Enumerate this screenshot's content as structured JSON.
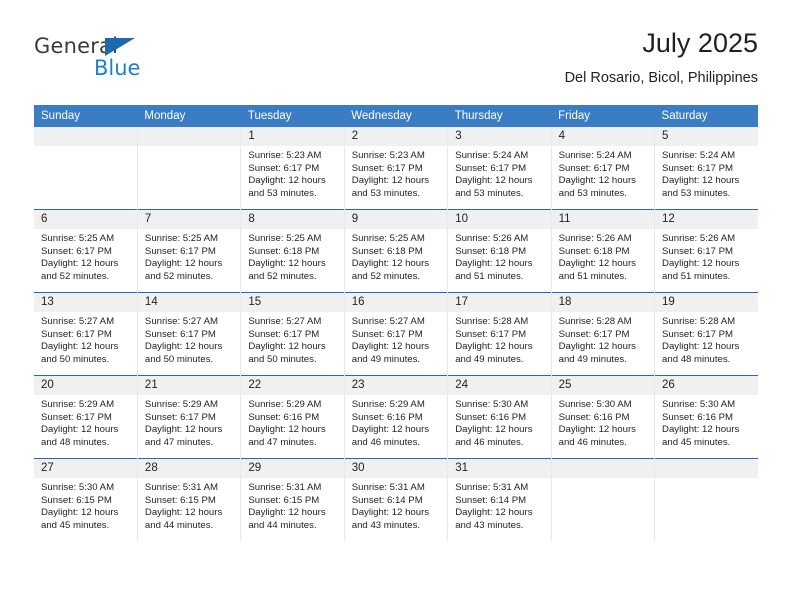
{
  "brand": {
    "name_top": "General",
    "name_bottom": "Blue",
    "triangle_icon": "triangle-icon",
    "color_dark": "#3b3b3b",
    "color_blue": "#1b7fd4",
    "color_triangle": "#1b68b3"
  },
  "header": {
    "title": "July 2025",
    "subtitle": "Del Rosario, Bicol, Philippines"
  },
  "colors": {
    "header_bar": "#3b7dc4",
    "row_divider": "#2a67ac",
    "day_band": "#f0f0f0",
    "text": "#231f20"
  },
  "weekdays": [
    "Sunday",
    "Monday",
    "Tuesday",
    "Wednesday",
    "Thursday",
    "Friday",
    "Saturday"
  ],
  "weeks": [
    [
      {
        "day": "",
        "lines": []
      },
      {
        "day": "",
        "lines": []
      },
      {
        "day": "1",
        "lines": [
          "Sunrise: 5:23 AM",
          "Sunset: 6:17 PM",
          "Daylight: 12 hours",
          "and 53 minutes."
        ]
      },
      {
        "day": "2",
        "lines": [
          "Sunrise: 5:23 AM",
          "Sunset: 6:17 PM",
          "Daylight: 12 hours",
          "and 53 minutes."
        ]
      },
      {
        "day": "3",
        "lines": [
          "Sunrise: 5:24 AM",
          "Sunset: 6:17 PM",
          "Daylight: 12 hours",
          "and 53 minutes."
        ]
      },
      {
        "day": "4",
        "lines": [
          "Sunrise: 5:24 AM",
          "Sunset: 6:17 PM",
          "Daylight: 12 hours",
          "and 53 minutes."
        ]
      },
      {
        "day": "5",
        "lines": [
          "Sunrise: 5:24 AM",
          "Sunset: 6:17 PM",
          "Daylight: 12 hours",
          "and 53 minutes."
        ]
      }
    ],
    [
      {
        "day": "6",
        "lines": [
          "Sunrise: 5:25 AM",
          "Sunset: 6:17 PM",
          "Daylight: 12 hours",
          "and 52 minutes."
        ]
      },
      {
        "day": "7",
        "lines": [
          "Sunrise: 5:25 AM",
          "Sunset: 6:17 PM",
          "Daylight: 12 hours",
          "and 52 minutes."
        ]
      },
      {
        "day": "8",
        "lines": [
          "Sunrise: 5:25 AM",
          "Sunset: 6:18 PM",
          "Daylight: 12 hours",
          "and 52 minutes."
        ]
      },
      {
        "day": "9",
        "lines": [
          "Sunrise: 5:25 AM",
          "Sunset: 6:18 PM",
          "Daylight: 12 hours",
          "and 52 minutes."
        ]
      },
      {
        "day": "10",
        "lines": [
          "Sunrise: 5:26 AM",
          "Sunset: 6:18 PM",
          "Daylight: 12 hours",
          "and 51 minutes."
        ]
      },
      {
        "day": "11",
        "lines": [
          "Sunrise: 5:26 AM",
          "Sunset: 6:18 PM",
          "Daylight: 12 hours",
          "and 51 minutes."
        ]
      },
      {
        "day": "12",
        "lines": [
          "Sunrise: 5:26 AM",
          "Sunset: 6:17 PM",
          "Daylight: 12 hours",
          "and 51 minutes."
        ]
      }
    ],
    [
      {
        "day": "13",
        "lines": [
          "Sunrise: 5:27 AM",
          "Sunset: 6:17 PM",
          "Daylight: 12 hours",
          "and 50 minutes."
        ]
      },
      {
        "day": "14",
        "lines": [
          "Sunrise: 5:27 AM",
          "Sunset: 6:17 PM",
          "Daylight: 12 hours",
          "and 50 minutes."
        ]
      },
      {
        "day": "15",
        "lines": [
          "Sunrise: 5:27 AM",
          "Sunset: 6:17 PM",
          "Daylight: 12 hours",
          "and 50 minutes."
        ]
      },
      {
        "day": "16",
        "lines": [
          "Sunrise: 5:27 AM",
          "Sunset: 6:17 PM",
          "Daylight: 12 hours",
          "and 49 minutes."
        ]
      },
      {
        "day": "17",
        "lines": [
          "Sunrise: 5:28 AM",
          "Sunset: 6:17 PM",
          "Daylight: 12 hours",
          "and 49 minutes."
        ]
      },
      {
        "day": "18",
        "lines": [
          "Sunrise: 5:28 AM",
          "Sunset: 6:17 PM",
          "Daylight: 12 hours",
          "and 49 minutes."
        ]
      },
      {
        "day": "19",
        "lines": [
          "Sunrise: 5:28 AM",
          "Sunset: 6:17 PM",
          "Daylight: 12 hours",
          "and 48 minutes."
        ]
      }
    ],
    [
      {
        "day": "20",
        "lines": [
          "Sunrise: 5:29 AM",
          "Sunset: 6:17 PM",
          "Daylight: 12 hours",
          "and 48 minutes."
        ]
      },
      {
        "day": "21",
        "lines": [
          "Sunrise: 5:29 AM",
          "Sunset: 6:17 PM",
          "Daylight: 12 hours",
          "and 47 minutes."
        ]
      },
      {
        "day": "22",
        "lines": [
          "Sunrise: 5:29 AM",
          "Sunset: 6:16 PM",
          "Daylight: 12 hours",
          "and 47 minutes."
        ]
      },
      {
        "day": "23",
        "lines": [
          "Sunrise: 5:29 AM",
          "Sunset: 6:16 PM",
          "Daylight: 12 hours",
          "and 46 minutes."
        ]
      },
      {
        "day": "24",
        "lines": [
          "Sunrise: 5:30 AM",
          "Sunset: 6:16 PM",
          "Daylight: 12 hours",
          "and 46 minutes."
        ]
      },
      {
        "day": "25",
        "lines": [
          "Sunrise: 5:30 AM",
          "Sunset: 6:16 PM",
          "Daylight: 12 hours",
          "and 46 minutes."
        ]
      },
      {
        "day": "26",
        "lines": [
          "Sunrise: 5:30 AM",
          "Sunset: 6:16 PM",
          "Daylight: 12 hours",
          "and 45 minutes."
        ]
      }
    ],
    [
      {
        "day": "27",
        "lines": [
          "Sunrise: 5:30 AM",
          "Sunset: 6:15 PM",
          "Daylight: 12 hours",
          "and 45 minutes."
        ]
      },
      {
        "day": "28",
        "lines": [
          "Sunrise: 5:31 AM",
          "Sunset: 6:15 PM",
          "Daylight: 12 hours",
          "and 44 minutes."
        ]
      },
      {
        "day": "29",
        "lines": [
          "Sunrise: 5:31 AM",
          "Sunset: 6:15 PM",
          "Daylight: 12 hours",
          "and 44 minutes."
        ]
      },
      {
        "day": "30",
        "lines": [
          "Sunrise: 5:31 AM",
          "Sunset: 6:14 PM",
          "Daylight: 12 hours",
          "and 43 minutes."
        ]
      },
      {
        "day": "31",
        "lines": [
          "Sunrise: 5:31 AM",
          "Sunset: 6:14 PM",
          "Daylight: 12 hours",
          "and 43 minutes."
        ]
      },
      {
        "day": "",
        "lines": []
      },
      {
        "day": "",
        "lines": []
      }
    ]
  ]
}
